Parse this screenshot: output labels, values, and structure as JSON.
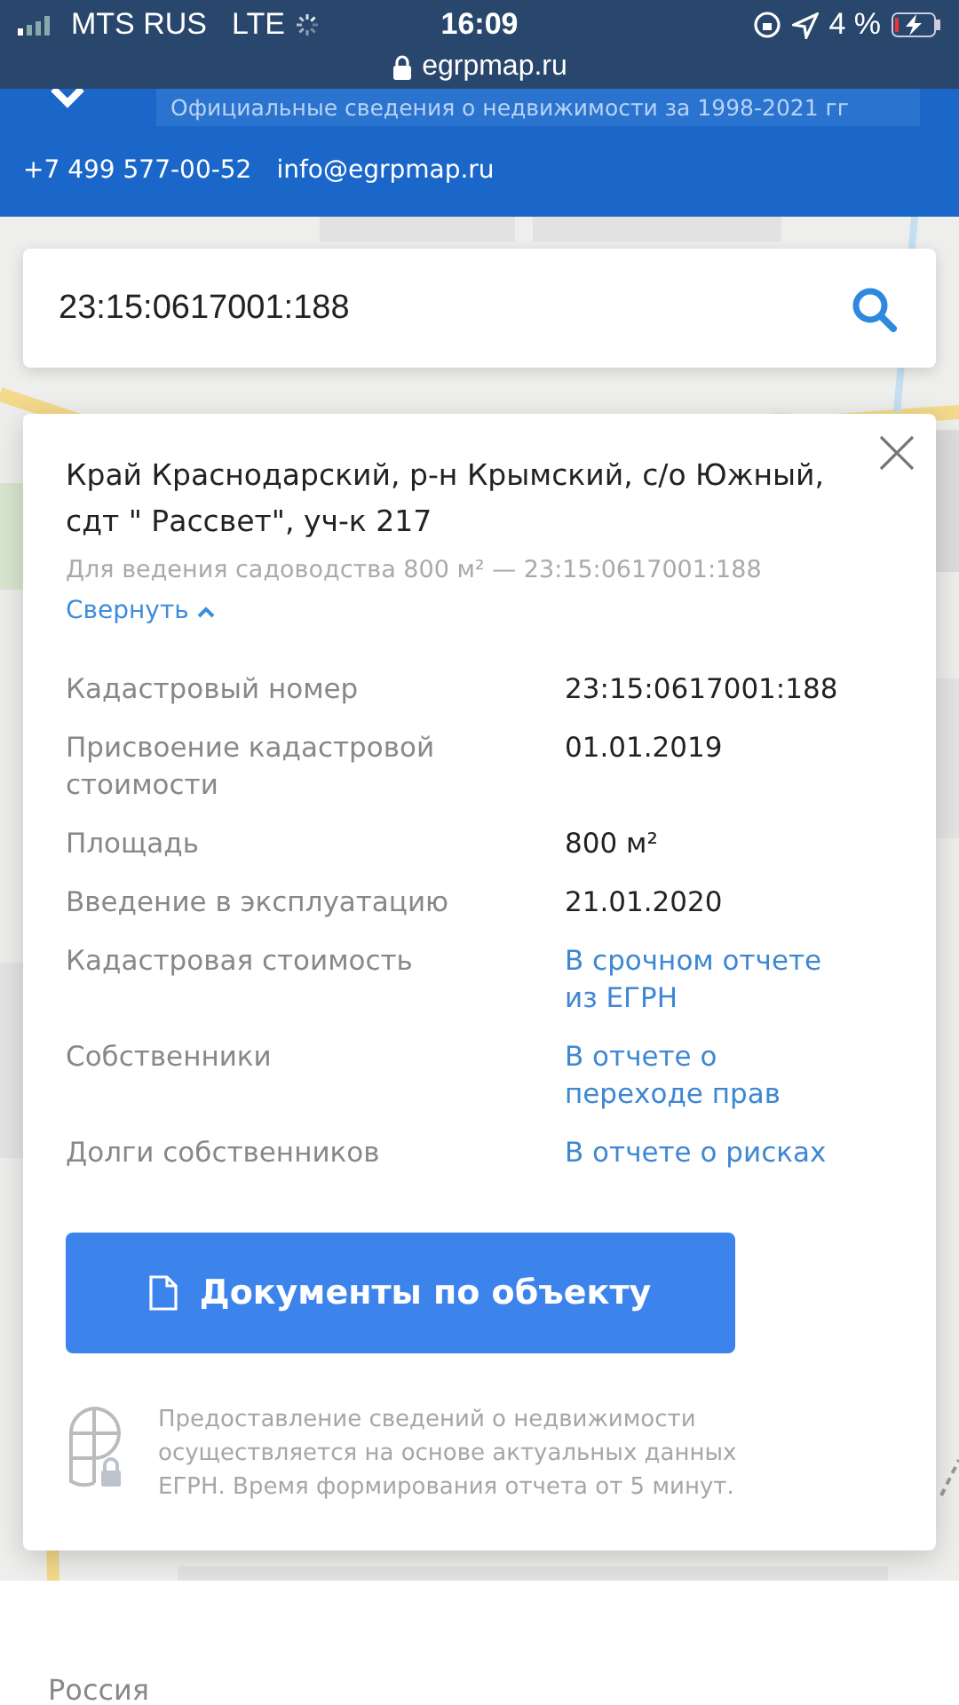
{
  "status_bar": {
    "carrier": "MTS RUS",
    "network": "LTE",
    "time": "16:09",
    "battery": "4 %",
    "url": "egrpmap.ru"
  },
  "header": {
    "tagline": "Официальные сведения о недвижимости за 1998-2021 гг",
    "phone": "+7 499 577-00-52",
    "email": "info@egrpmap.ru"
  },
  "search": {
    "value": "23:15:0617001:188"
  },
  "card": {
    "title": "Край Краснодарский, р-н Крымский, с/о Южный, сдт \" Рассвет\", уч-к 217",
    "subtitle": "Для ведения садоводства 800 м² — 23:15:0617001:188",
    "collapse_link": "Свернуть",
    "expanded": true,
    "rows": [
      {
        "label": "Кадастровый номер",
        "value": "23:15:0617001:188",
        "kind": "text"
      },
      {
        "label": "Присвоение кадастровой стоимости",
        "value": "01.01.2019",
        "kind": "text"
      },
      {
        "label": "Площадь",
        "value": "800 м²",
        "kind": "text"
      },
      {
        "label": "Введение в эксплуатацию",
        "value": "21.01.2020",
        "kind": "text"
      },
      {
        "label": "Кадастровая стоимость",
        "value": "В срочном отчете из ЕГРН",
        "kind": "link"
      },
      {
        "label": "Собственники",
        "value": "В отчете о переходе прав",
        "kind": "link"
      },
      {
        "label": "Долги собственников",
        "value": "В отчете о рисках",
        "kind": "link"
      }
    ],
    "button": "Документы по объекту",
    "note": "Предоставление сведений о недвижимости осуществляется на основе актуальных данных ЕГРН. Время формирования отчета от 5 минут."
  },
  "footer": {
    "country": "Россия"
  }
}
